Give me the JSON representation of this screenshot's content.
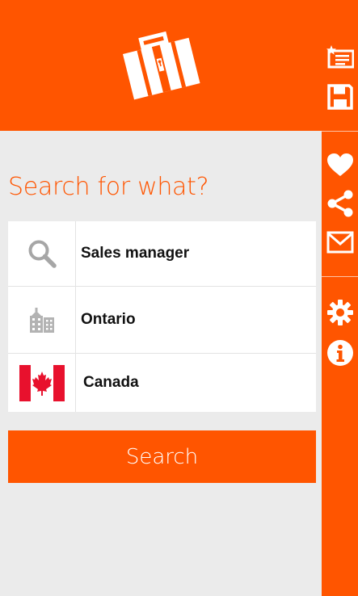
{
  "colors": {
    "accent": "#ff5500",
    "background": "#ebebeb",
    "field_background": "#ffffff",
    "text": "#111111",
    "icon_gray": "#a6a6a6"
  },
  "header": {
    "logo_icon": "suitcase-icon"
  },
  "sidebar": {
    "top_items": [
      {
        "icon": "saved-searches-icon"
      },
      {
        "icon": "save-icon"
      }
    ],
    "middle_items": [
      {
        "icon": "heart-icon"
      },
      {
        "icon": "share-icon"
      },
      {
        "icon": "mail-icon"
      }
    ],
    "bottom_items": [
      {
        "icon": "gear-icon"
      },
      {
        "icon": "info-icon"
      }
    ]
  },
  "search": {
    "heading": "Search for what?",
    "fields": {
      "keyword": {
        "icon": "search-icon",
        "value": "Sales manager"
      },
      "location": {
        "icon": "city-icon",
        "value": "Ontario"
      },
      "country": {
        "icon": "canada-flag-icon",
        "value": "Canada"
      }
    },
    "button_label": "Search"
  }
}
